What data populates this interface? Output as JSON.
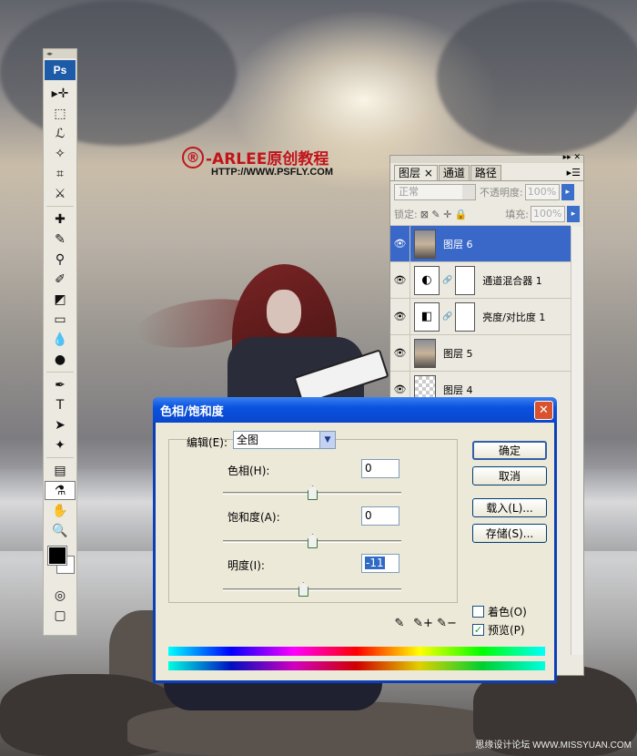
{
  "watermark": {
    "logo_symbol": "®",
    "logo_text": "-ARLEE原创教程",
    "url": "HTTP://WWW.PSFLY.COM",
    "site": "思缘设计论坛 WWW.MISSYUAN.COM"
  },
  "toolbox": {
    "app_badge": "Ps",
    "grip": "◂▸",
    "tools": [
      {
        "name": "move-tool-icon",
        "glyph": "▸✛"
      },
      {
        "name": "marquee-tool-icon",
        "glyph": "⬚"
      },
      {
        "name": "lasso-tool-icon",
        "glyph": "ℒ"
      },
      {
        "name": "magic-wand-tool-icon",
        "glyph": "✧"
      },
      {
        "name": "crop-tool-icon",
        "glyph": "⌗"
      },
      {
        "name": "slice-tool-icon",
        "glyph": "⚔"
      },
      {
        "name": "healing-brush-tool-icon",
        "glyph": "✚"
      },
      {
        "name": "brush-tool-icon",
        "glyph": "✎"
      },
      {
        "name": "clone-stamp-tool-icon",
        "glyph": "⚲"
      },
      {
        "name": "history-brush-tool-icon",
        "glyph": "✐"
      },
      {
        "name": "eraser-tool-icon",
        "glyph": "◩"
      },
      {
        "name": "gradient-tool-icon",
        "glyph": "▭"
      },
      {
        "name": "blur-tool-icon",
        "glyph": "💧"
      },
      {
        "name": "dodge-tool-icon",
        "glyph": "●"
      },
      {
        "name": "pen-tool-icon",
        "glyph": "✒"
      },
      {
        "name": "type-tool-icon",
        "glyph": "T"
      },
      {
        "name": "path-selection-tool-icon",
        "glyph": "➤"
      },
      {
        "name": "shape-tool-icon",
        "glyph": "✦"
      },
      {
        "name": "notes-tool-icon",
        "glyph": "▤"
      },
      {
        "name": "eyedropper-tool-icon",
        "glyph": "⚗"
      },
      {
        "name": "hand-tool-icon",
        "glyph": "✋"
      },
      {
        "name": "zoom-tool-icon",
        "glyph": "🔍"
      }
    ],
    "quickmask": "◎",
    "screenmode": "▢"
  },
  "layers_panel": {
    "tabs": [
      "图层",
      "通道",
      "路径"
    ],
    "tab_close": "×",
    "menu_icon": "▸☰",
    "top_icons": "▸▸ ✕",
    "blend_mode": "正常",
    "opacity_label": "不透明度:",
    "opacity_value": "100%",
    "lock_label": "锁定:",
    "lock_icons": "⊠ ✎ ✛ 🔒",
    "fill_label": "填充:",
    "fill_value": "100%",
    "arrow": "▸",
    "eye": "👁",
    "chain": "🔗",
    "layers": [
      {
        "name": "图层 6"
      },
      {
        "name": "通道混合器 1"
      },
      {
        "name": "亮度/对比度 1"
      },
      {
        "name": "图层 5"
      },
      {
        "name": "图层 4"
      }
    ]
  },
  "dialog": {
    "title": "色相/饱和度",
    "close": "✕",
    "edit_label": "编辑(E):",
    "edit_value": "全图",
    "dd_arrow": "▼",
    "hue_label": "色相(H):",
    "hue_value": "0",
    "sat_label": "饱和度(A):",
    "sat_value": "0",
    "light_label": "明度(I):",
    "light_value": "-11",
    "ok": "确定",
    "cancel": "取消",
    "load": "载入(L)...",
    "save": "存储(S)...",
    "colorize": "着色(O)",
    "preview": "预览(P)",
    "check": "✓",
    "droppers": [
      "✎",
      "✎+",
      "✎−"
    ]
  }
}
